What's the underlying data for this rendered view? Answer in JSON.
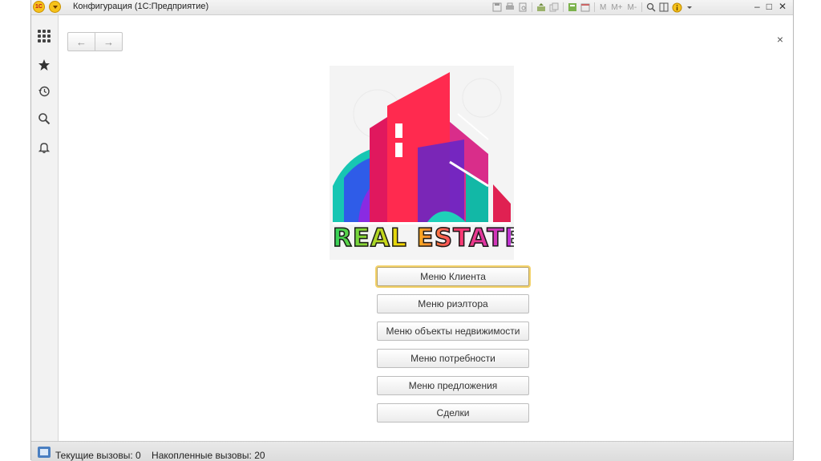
{
  "window": {
    "title": "Конфигурация  (1С:Предприятие)",
    "app_logo": "1С",
    "toolbar_text_buttons": [
      "M",
      "M+",
      "M-"
    ],
    "controls": [
      "–",
      "□",
      "✕"
    ]
  },
  "sidebar": {
    "items": [
      {
        "name": "sections-icon"
      },
      {
        "name": "favorites-icon"
      },
      {
        "name": "history-icon"
      },
      {
        "name": "search-icon"
      },
      {
        "name": "notifications-icon"
      }
    ]
  },
  "nav": {
    "back": "←",
    "forward": "→",
    "close": "×"
  },
  "logo": {
    "text": "REAL ESTATE"
  },
  "menu": {
    "buttons": [
      "Меню Клиента",
      "Меню риэлтора",
      "Меню объекты недвижимости",
      "Меню потребности",
      "Меню предложения",
      "Сделки"
    ]
  },
  "status": {
    "current_calls": "Текущие вызовы: 0",
    "accumulated_calls": "Накопленные вызовы: 20"
  },
  "colors": {
    "accent_yellow": "#f6c21a",
    "focus_border": "#f3d26a",
    "logo_red": "#ff2d55",
    "logo_purple": "#7b2ff7",
    "logo_teal": "#1ec8b0"
  }
}
